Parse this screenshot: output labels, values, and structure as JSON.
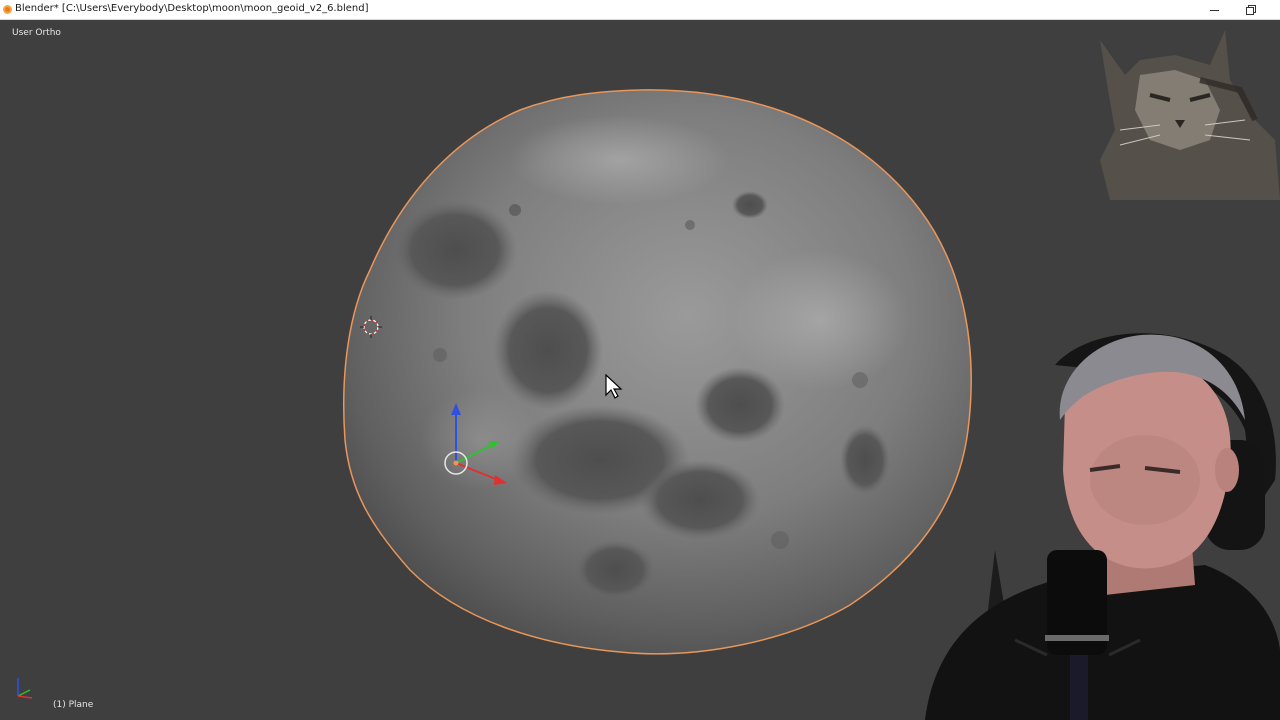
{
  "window": {
    "title": "Blender* [C:\\Users\\Everybody\\Desktop\\moon\\moon_geoid_v2_6.blend]"
  },
  "viewport": {
    "view_label": "User Ortho",
    "object_label": "(1) Plane"
  },
  "icons": {
    "app": "blender-icon",
    "minimize": "minimize-icon",
    "restore": "restore-icon",
    "cursor3d": "3d-cursor-icon",
    "gizmo": "transform-gizmo-icon",
    "mouse": "mouse-pointer-icon",
    "axes": "axes-orientation-icon"
  },
  "colors": {
    "viewport_bg": "#3f3f3f",
    "selection_outline": "#e8965a",
    "axis_x": "#e03030",
    "axis_y": "#30c030",
    "axis_z": "#3050e0"
  }
}
